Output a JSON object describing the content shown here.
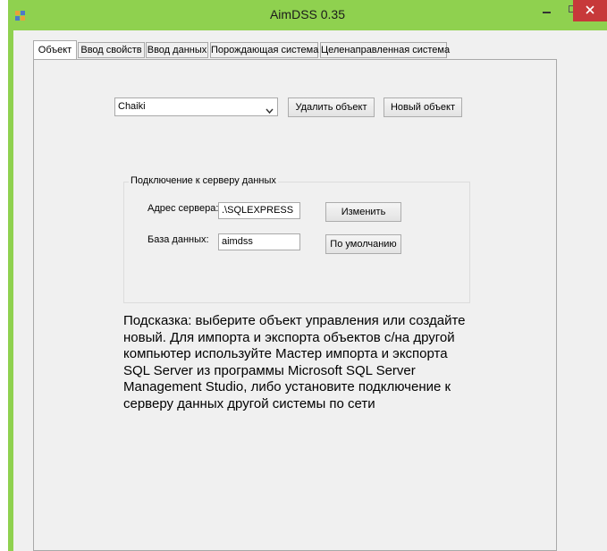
{
  "window": {
    "title": "AimDSS 0.35"
  },
  "tabs": [
    {
      "label": "Объект",
      "active": true
    },
    {
      "label": "Ввод свойств",
      "active": false
    },
    {
      "label": "Ввод данных",
      "active": false
    },
    {
      "label": "Порождающая система",
      "active": false
    },
    {
      "label": "Целенаправленная система",
      "active": false
    }
  ],
  "object_panel": {
    "object_select_value": "Chaiki",
    "delete_button": "Удалить объект",
    "new_button": "Новый объект"
  },
  "connection_group": {
    "title": "Подключение к серверу данных",
    "server_label": "Адрес сервера:",
    "server_value": ".\\SQLEXPRESS",
    "change_button": "Изменить",
    "database_label": "База данных:",
    "database_value": "aimdss",
    "default_button": "По умолчанию"
  },
  "hint_text": "Подсказка: выберите объект управления или создайте новый. Для импорта и экспорта объектов с/на другой компьютер используйте Мастер импорта и экспорта SQL Server из программы Microsoft SQL Server Management Studio, либо установите подключение к серверу данных другой системы по сети",
  "colors": {
    "title_bar": "#8fd14f",
    "close_button": "#c7393a",
    "client_background": "#f0f0f0"
  },
  "icons": {
    "app": "app-icon",
    "minimize": "minimize-icon",
    "maximize": "maximize-icon",
    "close": "close-icon",
    "dropdown": "chevron-down-icon"
  }
}
